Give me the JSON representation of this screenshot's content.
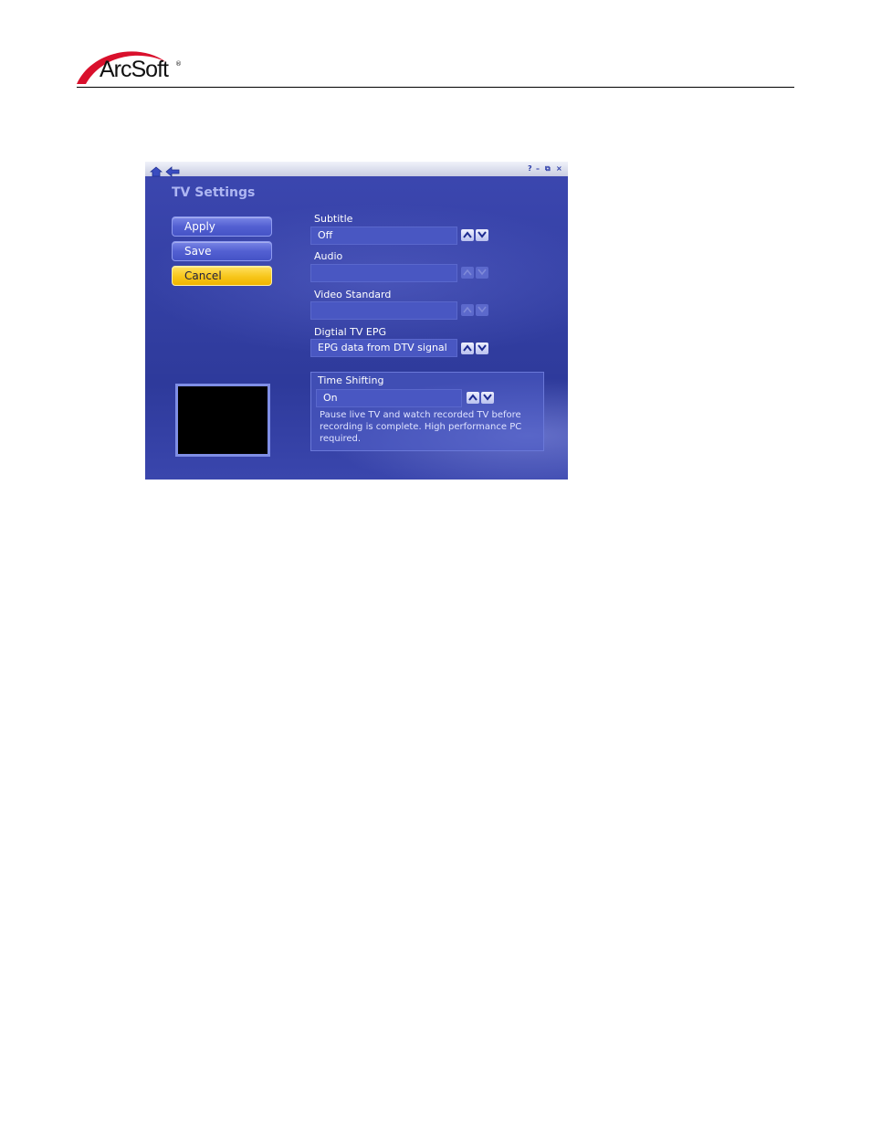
{
  "logo": {
    "text": "ArcSoft",
    "reg_mark": "®",
    "arc_color": "#d9102c"
  },
  "app": {
    "title": "TV Settings",
    "window_controls": {
      "help": "?",
      "minimize": "–",
      "restore": "⧉",
      "close": "×"
    },
    "buttons": {
      "apply": "Apply",
      "save": "Save",
      "cancel": "Cancel"
    },
    "settings": {
      "subtitle": {
        "label": "Subtitle",
        "value": "Off"
      },
      "audio": {
        "label": "Audio",
        "value": ""
      },
      "video_standard": {
        "label": "Video Standard",
        "value": ""
      },
      "digital_tv_epg": {
        "label": "Digtial TV EPG",
        "value": "EPG data from DTV signal"
      },
      "time_shifting": {
        "label": "Time Shifting",
        "value": "On",
        "description": "Pause live TV and watch recorded TV before recording is complete. High performance PC required."
      }
    },
    "colors": {
      "background": "#3440a4",
      "button": "#5360d2",
      "cancel_button": "#f7c61a",
      "heading": "#aeb6f2"
    }
  }
}
